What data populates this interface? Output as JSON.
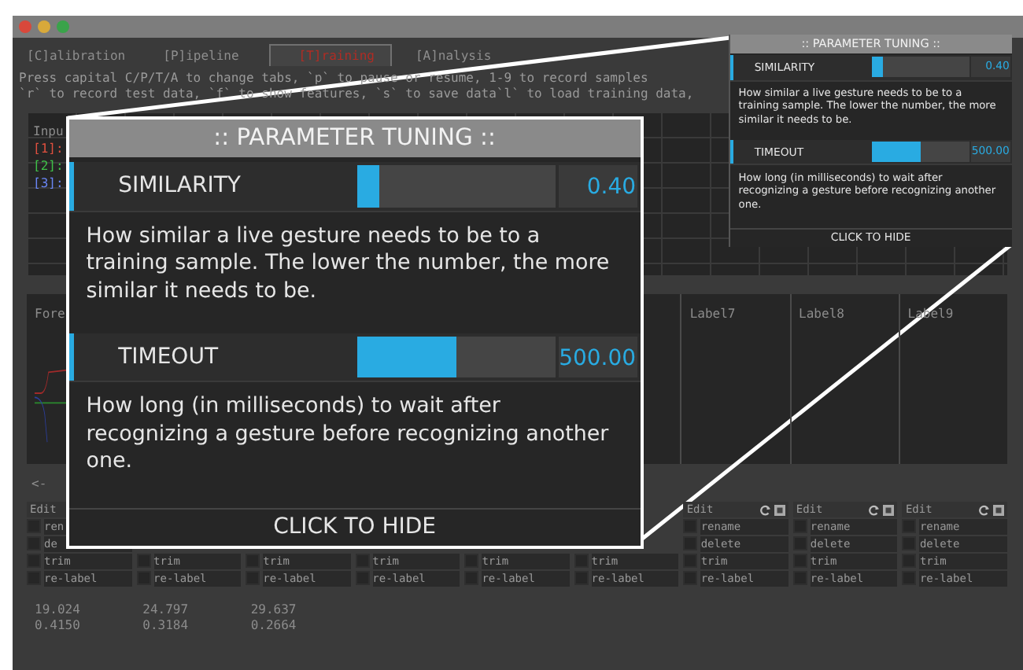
{
  "window": {
    "tabs": [
      {
        "label": "[C]alibration",
        "selected": false
      },
      {
        "label": "[P]ipeline",
        "selected": false
      },
      {
        "label": "[T]raining",
        "selected": true
      },
      {
        "label": "[A]nalysis",
        "selected": false
      }
    ],
    "instructions": [
      "Press capital C/P/T/A to change tabs, `p` to pause or resume, 1-9 to record samples",
      "`r` to record test data, `f` to show features, `s` to save data`l` to load training data,"
    ],
    "input_plot": {
      "title": "Inpu",
      "channels": [
        {
          "label": "[1]:",
          "color": "#e0503f"
        },
        {
          "label": "[2]:",
          "color": "#3fc048"
        },
        {
          "label": "[3]:",
          "color": "#6a86f5"
        }
      ]
    },
    "sample_plot": {
      "title": "Fore",
      "labels": [
        "Label7",
        "Label8",
        "Label9"
      ]
    },
    "nav": "<-",
    "edit_columns": [
      {
        "header": "Edit",
        "actions": [
          {
            "label": "ren",
            "checked": false
          },
          {
            "label": "de",
            "checked": false
          },
          {
            "label": "trim",
            "checked": false
          },
          {
            "label": "re-label",
            "checked": false
          }
        ]
      },
      {
        "actions": [
          {
            "label": "trim",
            "checked": false
          },
          {
            "label": "re-label",
            "checked": false
          }
        ]
      },
      {
        "actions": [
          {
            "label": "trim",
            "checked": false
          },
          {
            "label": "re-label",
            "checked": false
          }
        ]
      },
      {
        "actions": [
          {
            "label": "trim",
            "checked": false
          },
          {
            "label": "re-label",
            "checked": false
          }
        ]
      },
      {
        "actions": [
          {
            "label": "trim",
            "checked": false
          },
          {
            "label": "re-label",
            "checked": false
          }
        ]
      },
      {
        "actions": [
          {
            "label": "trim",
            "checked": false
          },
          {
            "label": "re-label",
            "checked": false
          }
        ]
      },
      {
        "header": "Edit",
        "actions": [
          {
            "label": "rename",
            "checked": false
          },
          {
            "label": "delete",
            "checked": false
          },
          {
            "label": "trim",
            "checked": false
          },
          {
            "label": "re-label",
            "checked": false
          }
        ]
      },
      {
        "header": "Edit",
        "actions": [
          {
            "label": "rename",
            "checked": false
          },
          {
            "label": "delete",
            "checked": false
          },
          {
            "label": "trim",
            "checked": false
          },
          {
            "label": "re-label",
            "checked": false
          }
        ]
      },
      {
        "header": "Edit",
        "actions": [
          {
            "label": "rename",
            "checked": false
          },
          {
            "label": "delete",
            "checked": false
          },
          {
            "label": "trim",
            "checked": false
          },
          {
            "label": "re-label",
            "checked": false
          }
        ]
      }
    ],
    "stats": [
      [
        "19.024",
        "0.4150"
      ],
      [
        "24.797",
        "0.3184"
      ],
      [
        "29.637",
        "0.2664"
      ]
    ]
  },
  "tuning_panel": {
    "title": ":: PARAMETER TUNING ::",
    "params": [
      {
        "name": "SIMILARITY",
        "level": 0.11,
        "value": "0.40",
        "description": "How similar a live gesture needs to be to a training sample. The lower the number, the more similar it needs to be."
      },
      {
        "name": "TIMEOUT",
        "level": 0.5,
        "value": "500.00",
        "description": "How long (in milliseconds) to wait after recognizing a gesture before recognizing another one."
      }
    ],
    "hide_label": "CLICK TO HIDE"
  },
  "magnified_tuning_panel": {
    "title": ":: PARAMETER TUNING ::",
    "params": [
      {
        "name": "SIMILARITY",
        "level": 0.11,
        "value": "0.40",
        "description": "How similar a live gesture needs to be to a training sample. The lower the number, the more similar it needs to be."
      },
      {
        "name": "TIMEOUT",
        "level": 0.5,
        "value": "500.00",
        "description": "How long (in milliseconds) to wait after recognizing a gesture before recognizing another one."
      }
    ],
    "hide_label": "CLICK TO HIDE"
  }
}
